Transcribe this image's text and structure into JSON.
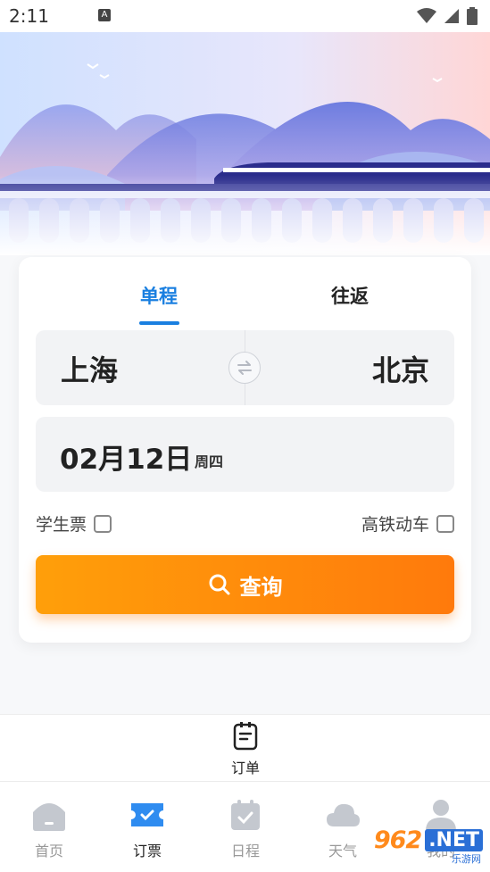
{
  "status_bar": {
    "time": "2:11",
    "notification_badge": "A",
    "icons": [
      "wifi-icon",
      "signal-icon",
      "battery-icon"
    ]
  },
  "booking": {
    "tabs": [
      {
        "label": "单程",
        "active": true
      },
      {
        "label": "往返",
        "active": false
      }
    ],
    "from_station": "上海",
    "to_station": "北京",
    "date": "02月12日",
    "weekday": "周四",
    "options": {
      "student_ticket_label": "学生票",
      "student_ticket_checked": false,
      "high_speed_label": "高铁动车",
      "high_speed_checked": false
    },
    "search_label": "查询"
  },
  "orders": {
    "label": "订单"
  },
  "bottom_nav": [
    {
      "label": "首页",
      "icon": "home-icon",
      "active": false
    },
    {
      "label": "订票",
      "icon": "ticket-icon",
      "active": true
    },
    {
      "label": "日程",
      "icon": "calendar-icon",
      "active": false
    },
    {
      "label": "天气",
      "icon": "cloud-icon",
      "active": false
    },
    {
      "label": "我的",
      "icon": "user-icon",
      "active": false
    }
  ],
  "watermark": {
    "brand": "962",
    "suffix": ".NET",
    "caption": "乐游网"
  },
  "colors": {
    "accent_blue": "#1a7fe0",
    "button_orange": "#ff8a0c",
    "nav_active": "#2f8cf0",
    "nav_inactive": "#b8bcc4"
  }
}
